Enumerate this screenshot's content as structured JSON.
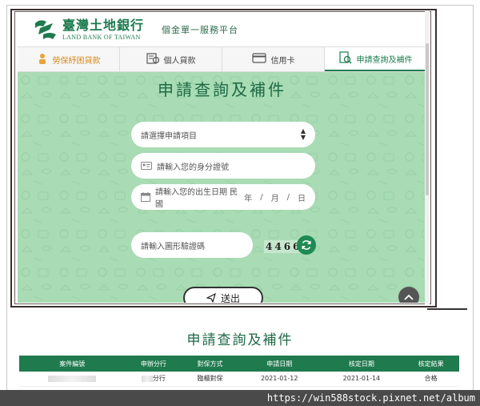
{
  "header": {
    "logo_cn": "臺灣土地銀行",
    "logo_en": "LAND BANK OF TAIWAN",
    "platform_title": "個金單一服務平台"
  },
  "tabs": [
    {
      "label": "勞保紓困貸款",
      "icon": "worker-icon",
      "color": "#d98a1c"
    },
    {
      "label": "個人貸款",
      "icon": "loan-document-icon"
    },
    {
      "label": "信用卡",
      "icon": "credit-card-icon"
    },
    {
      "label": "申請查詢及補件",
      "icon": "search-document-icon",
      "active": true
    }
  ],
  "form": {
    "title": "申請查詢及補件",
    "select_placeholder": "請選擇申請項目",
    "id_placeholder": "請輸入您的身分證號",
    "birth_placeholder": "請輸入您的出生日期 民國",
    "birth_year": "年",
    "birth_month": "月",
    "birth_day": "日",
    "date_sep": "/",
    "captcha_placeholder": "請輸入圖形驗證碼",
    "captcha_code": "4466",
    "submit_label": "送出"
  },
  "results": {
    "title": "申請查詢及補件",
    "columns": [
      "案件編號",
      "申辦分行",
      "對保方式",
      "申請日期",
      "核定日期",
      "核定結果"
    ],
    "rows": [
      [
        "",
        "分行",
        "臨櫃對保",
        "2021-01-12",
        "2021-01-14",
        "合格"
      ]
    ]
  },
  "watermark": "https://win588stock.pixnet.net/album",
  "colors": {
    "brand_green": "#1d7b4e",
    "hero_bg": "#a9dbb4",
    "table_header": "#1f7a4d",
    "tab_highlight": "#d98a1c"
  }
}
